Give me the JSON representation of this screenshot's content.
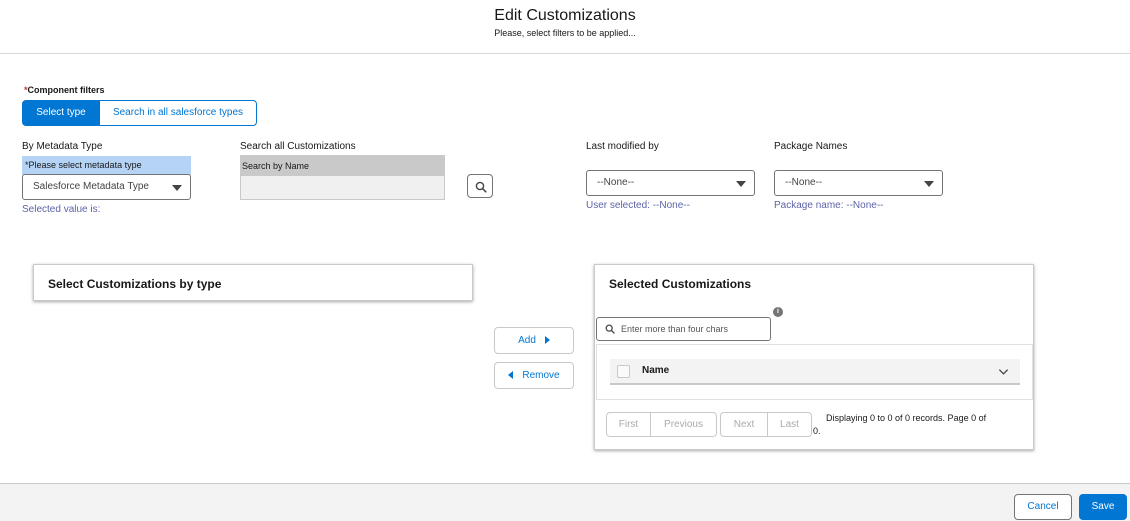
{
  "header": {
    "title": "Edit Customizations",
    "subtitle": "Please, select filters to be applied..."
  },
  "component_filters": {
    "required_marker": "*",
    "label": "Component filters",
    "toggle_options": [
      "Select type",
      "Search in all salesforce types"
    ],
    "selected": "Select type"
  },
  "metadata_type": {
    "label": "By Metadata Type",
    "hint_required_marker": "*",
    "hint": "Please select metadata type",
    "select_value": "Salesforce Metadata Type",
    "selected_value_text": "Selected value is:"
  },
  "search_all": {
    "label": "Search all Customizations",
    "placeholder": "Search by Name",
    "button_icon": "search-icon"
  },
  "last_modified": {
    "label": "Last modified by",
    "select_value": "--None--",
    "helper": "User selected: --None--"
  },
  "package_names": {
    "label": "Package Names",
    "select_value": "--None--",
    "helper": "Package name: --None--"
  },
  "left_panel": {
    "title": "Select Customizations by type"
  },
  "actions": {
    "add_label": "Add",
    "remove_label": "Remove"
  },
  "right_panel": {
    "title": "Selected Customizations",
    "info_icon": "info-icon",
    "filter_placeholder": "Enter more than four chars",
    "table": {
      "columns": [
        "Name"
      ],
      "rows": []
    },
    "pager": {
      "buttons": [
        "First",
        "Previous",
        "Next",
        "Last"
      ],
      "status_line1": "Displaying 0 to 0 of 0 records. Page 0 of",
      "status_line2": "0."
    }
  },
  "footer": {
    "cancel_label": "Cancel",
    "save_label": "Save"
  },
  "colors": {
    "brand": "#0176d3",
    "hint_bg": "#b5d3f5",
    "helper_text": "#5d63a8",
    "required": "#c23934"
  }
}
